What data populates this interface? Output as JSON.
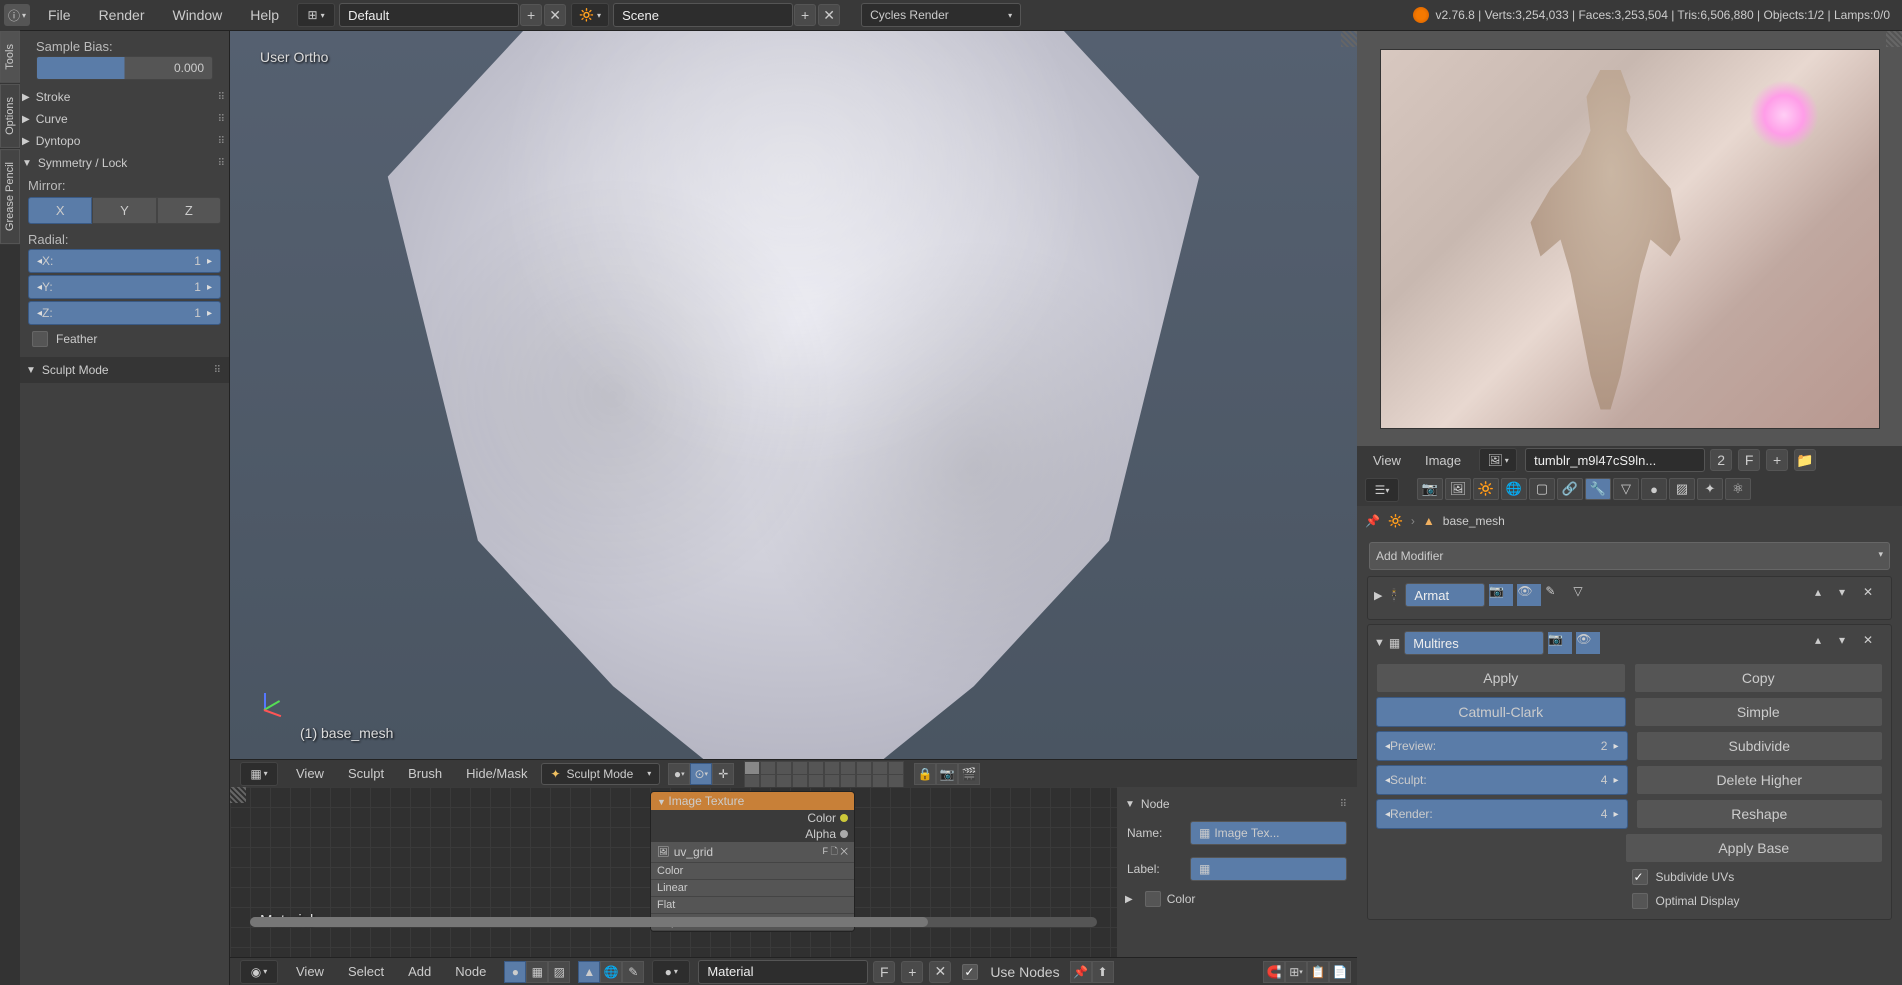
{
  "top": {
    "menus": [
      "File",
      "Render",
      "Window",
      "Help"
    ],
    "layout": "Default",
    "scene": "Scene",
    "engine": "Cycles Render",
    "stats": "v2.76.8 | Verts:3,254,033 | Faces:3,253,504 | Tris:6,506,880 | Objects:1/2 | Lamps:0/0"
  },
  "left_tabs": [
    "Tools",
    "Options",
    "Grease Pencil"
  ],
  "tool_panel": {
    "sample_bias_label": "Sample Bias:",
    "sample_bias_val": "0.000",
    "sections": [
      "Stroke",
      "Curve",
      "Dyntopo",
      "Symmetry / Lock"
    ],
    "mirror_label": "Mirror:",
    "mirror_axes": [
      "X",
      "Y",
      "Z"
    ],
    "radial_label": "Radial:",
    "radial": {
      "x_label": "X:",
      "x_val": "1",
      "y_label": "Y:",
      "y_val": "1",
      "z_label": "Z:",
      "z_val": "1"
    },
    "feather": "Feather",
    "sculpt_mode_header": "Sculpt Mode"
  },
  "view3d": {
    "overlay_view": "User Ortho",
    "overlay_obj": "(1) base_mesh",
    "header_menus": [
      "View",
      "Sculpt",
      "Brush",
      "Hide/Mask"
    ],
    "mode": "Sculpt Mode"
  },
  "node_editor": {
    "node_title": "Image Texture",
    "out_color": "Color",
    "out_alpha": "Alpha",
    "image_name": "uv_grid",
    "opts": [
      "Color",
      "Linear",
      "Flat",
      "Repeat"
    ],
    "material_label": "Material",
    "header_menus": [
      "View",
      "Select",
      "Add",
      "Node"
    ],
    "material_name": "Material",
    "use_nodes": "Use Nodes",
    "side_node": "Node",
    "side_name_label": "Name:",
    "side_name_val": "Image Tex...",
    "side_label_label": "Label:",
    "side_color": "Color"
  },
  "image_panel": {
    "menus": [
      "View",
      "Image"
    ],
    "image_name": "tumblr_m9l47cS9ln...",
    "users": "2",
    "fake": "F"
  },
  "properties": {
    "breadcrumb_obj": "base_mesh",
    "add_modifier": "Add Modifier",
    "mod1_name": "Armat",
    "mod2_name": "Multires",
    "apply": "Apply",
    "copy": "Copy",
    "catmull": "Catmull-Clark",
    "simple": "Simple",
    "preview_label": "Preview:",
    "preview_val": "2",
    "sculpt_label": "Sculpt:",
    "sculpt_val": "4",
    "render_label": "Render:",
    "render_val": "4",
    "subdivide": "Subdivide",
    "delete_higher": "Delete Higher",
    "reshape": "Reshape",
    "apply_base": "Apply Base",
    "subdivide_uvs": "Subdivide UVs",
    "optimal_display": "Optimal Display"
  }
}
